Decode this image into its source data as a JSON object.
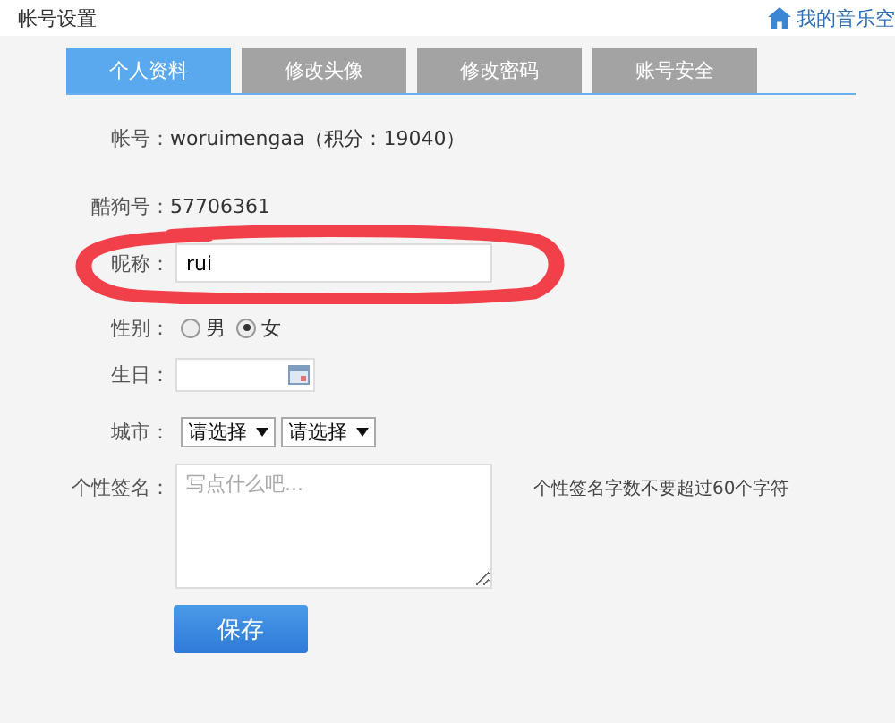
{
  "header": {
    "title": "帐号设置",
    "link": "我的音乐空"
  },
  "tabs": [
    {
      "label": "个人资料",
      "selected": true
    },
    {
      "label": "修改头像",
      "selected": false
    },
    {
      "label": "修改密码",
      "selected": false
    },
    {
      "label": "账号安全",
      "selected": false
    }
  ],
  "form": {
    "account": {
      "label": "帐号：",
      "value": "woruimengaa（积分：19040）"
    },
    "kugou_id": {
      "label": "酷狗号：",
      "value": "57706361"
    },
    "nickname": {
      "label": "昵称：",
      "value": "rui"
    },
    "gender": {
      "label": "性别：",
      "options": [
        {
          "label": "男",
          "selected": false
        },
        {
          "label": "女",
          "selected": true
        }
      ]
    },
    "birthday": {
      "label": "生日："
    },
    "city": {
      "label": "城市：",
      "selects": [
        "请选择",
        "请选择"
      ]
    },
    "signature": {
      "label": "个性签名：",
      "placeholder": "写点什么吧...",
      "hint": "个性签名字数不要超过60个字符"
    },
    "save": "保存"
  },
  "annotation": {
    "kind": "ellipse"
  }
}
